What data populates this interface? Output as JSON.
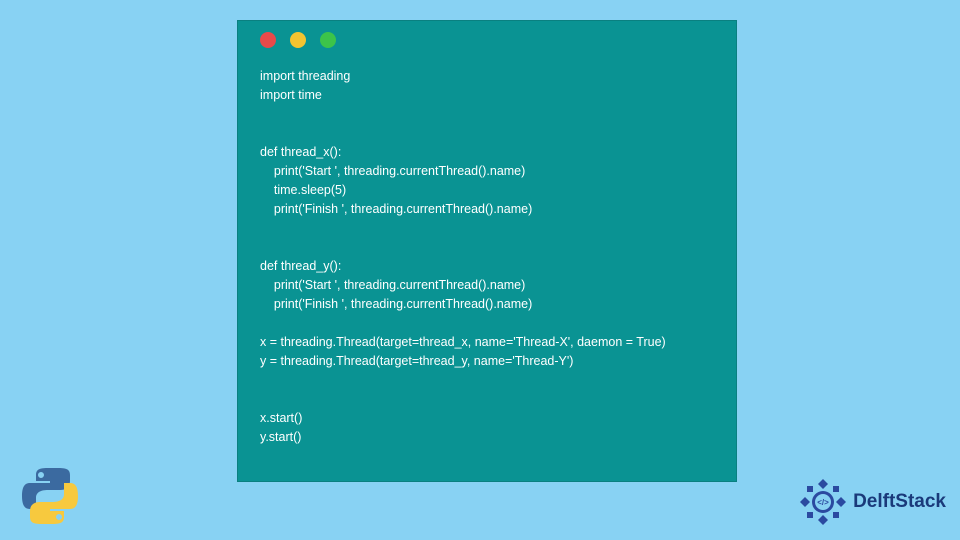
{
  "code": {
    "lines": [
      "import threading",
      "import time",
      "",
      "",
      "def thread_x():",
      "    print('Start ', threading.currentThread().name)",
      "    time.sleep(5)",
      "    print('Finish ', threading.currentThread().name)",
      "",
      "",
      "def thread_y():",
      "    print('Start ', threading.currentThread().name)",
      "    print('Finish ', threading.currentThread().name)",
      "",
      "x = threading.Thread(target=thread_x, name='Thread-X', daemon = True)",
      "y = threading.Thread(target=thread_y, name='Thread-Y')",
      "",
      "",
      "x.start()",
      "y.start()"
    ]
  },
  "brand": {
    "name": "DelftStack"
  },
  "icons": {
    "python": "python-logo",
    "brand": "delftstack-logo"
  },
  "colors": {
    "page_bg": "#88d2f3",
    "window_bg": "#0a9393",
    "code_fg": "#ffffff",
    "dot_red": "#e84a4a",
    "dot_yellow": "#f4c430",
    "dot_green": "#3cc44a",
    "brand_text": "#1a3a7a"
  }
}
